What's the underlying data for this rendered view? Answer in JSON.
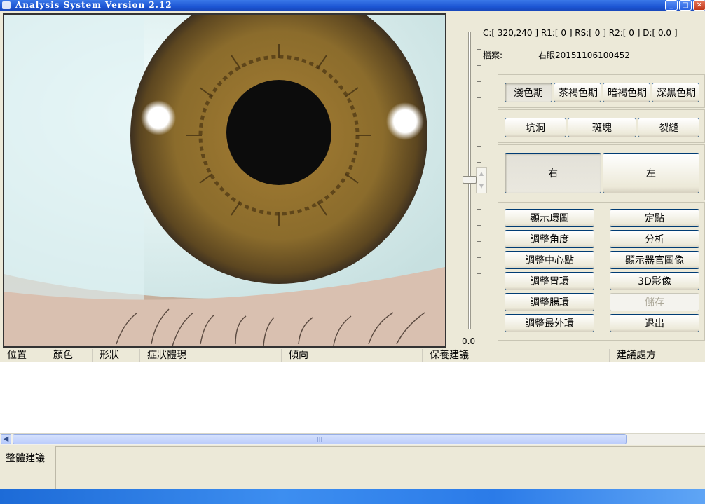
{
  "window": {
    "title": "Analysis System Version 2.12",
    "controls": [
      "_",
      "□",
      "✕"
    ]
  },
  "info": {
    "status": "C:[ 320,240 ] R1:[  0 ] RS:[  0 ] R2:[  0 ] D:[ 0.0 ]",
    "file_label": "檔案:",
    "file_value": "右眼20151106100452"
  },
  "slider": {
    "value": "0.0",
    "level": 0.5
  },
  "buttons": {
    "color_periods": [
      "淺色期",
      "茶褐色期",
      "暗褐色期",
      "深黑色期"
    ],
    "markings": [
      "坑洞",
      "斑塊",
      "裂縫"
    ],
    "sides": [
      "右",
      "左"
    ],
    "actions_left": [
      "顯示環圖",
      "調整角度",
      "調整中心點",
      "調整胃環",
      "調整腸環",
      "調整最外環"
    ],
    "actions_right": [
      "定點",
      "分析",
      "顯示器官圖像",
      "3D影像",
      "儲存",
      "退出"
    ]
  },
  "table": {
    "columns": [
      "位置",
      "顏色",
      "形狀",
      "症狀體現",
      "傾向",
      "保養建議",
      "建議處方"
    ]
  },
  "suggestion": {
    "label": "整體建議"
  },
  "colors": {
    "iris": "#8a6a2a",
    "sclera": "#e8f4f4",
    "titlebar": "#1c55d4"
  }
}
